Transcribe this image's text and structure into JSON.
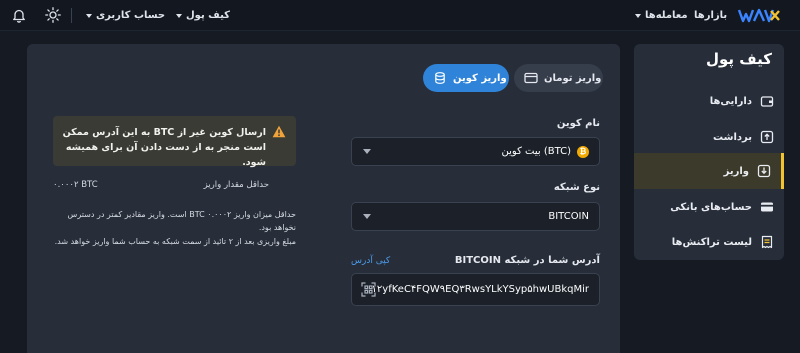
{
  "nav": {
    "markets": "بازارها",
    "trades": "معامله‌ها",
    "wallet": "کیف پول",
    "account": "حساب کاربری"
  },
  "sidebar": {
    "title": "کیف پول",
    "items": [
      {
        "label": "دارایی‌ها",
        "icon": "wallet-icon"
      },
      {
        "label": "برداشت",
        "icon": "upload-icon"
      },
      {
        "label": "واریز",
        "icon": "download-icon",
        "active": true
      },
      {
        "label": "حساب‌های بانکی",
        "icon": "card-icon"
      },
      {
        "label": "لیست تراکنش‌ها",
        "icon": "receipt-icon"
      }
    ]
  },
  "tabs": {
    "toman": "واریز تومان",
    "coin": "واریز کوین"
  },
  "form": {
    "coin_label": "نام کوین",
    "coin_value": "بیت کوین (BTC)",
    "network_label": "نوع شبکه",
    "network_value": "BITCOIN",
    "address_label": "آدرس شما در شبکه BITCOIN",
    "copy_label": "کپی آدرس",
    "address": "۱۲yfKeC۴FQW۹EQ۳RwsYLkYSyp۵hwUBkqMir"
  },
  "warning": {
    "text": "ارسال کوین غیر از BTC به این آدرس ممکن است منجر به از دست دادن آن برای همیشه شود."
  },
  "info": {
    "min_label": "حداقل مقدار واریز",
    "min_value": "۰.۰۰۰۲ BTC",
    "note1": "حداقل میزان واریز BTC ۰.۰۰۰۲ است. واریز مقادیر کمتر در دسترس نخواهد بود.",
    "note2": "مبلغ واریزی بعد از ۲ تائید از سمت شبکه به حساب شما واریز خواهد شد."
  },
  "colors": {
    "accent_blue": "#2f83d8",
    "active_yellow": "#f1c232",
    "bitcoin_orange": "#f2a900"
  }
}
